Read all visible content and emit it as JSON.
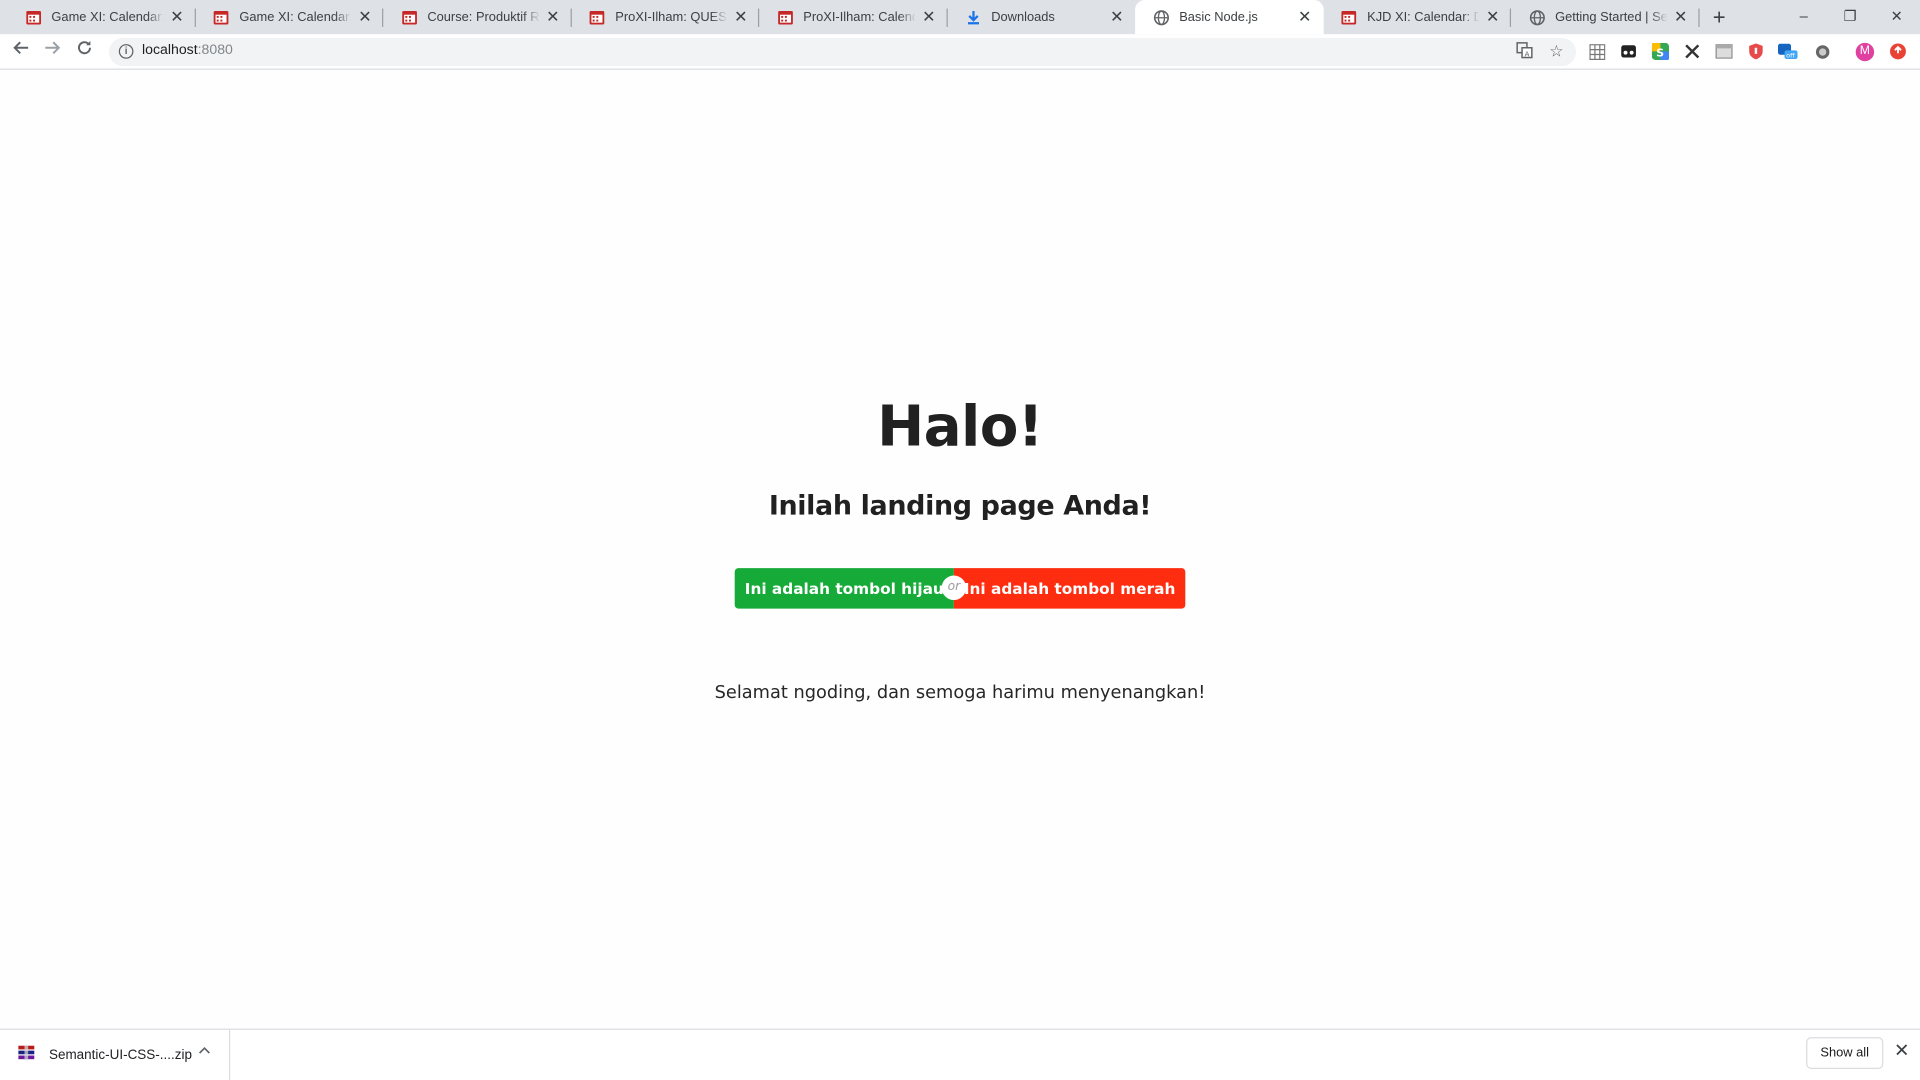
{
  "browser": {
    "tabs": [
      {
        "title": "Game XI: Calendar: Details",
        "icon": "google-classroom-icon",
        "active": false
      },
      {
        "title": "Game XI: Calendar: Details",
        "icon": "google-classroom-icon",
        "active": false
      },
      {
        "title": "Course: Produktif RPL XI",
        "icon": "google-classroom-icon",
        "active": false
      },
      {
        "title": "ProXI-Ilham: QUESTIONS",
        "icon": "google-classroom-icon",
        "active": false
      },
      {
        "title": "ProXI-Ilham: Calendar: Details",
        "icon": "google-classroom-icon",
        "active": false
      },
      {
        "title": "Downloads",
        "icon": "download-icon",
        "active": false
      },
      {
        "title": "Basic Node.js",
        "icon": "globe-icon",
        "active": true
      },
      {
        "title": "KJD XI: Calendar: Details",
        "icon": "google-classroom-icon",
        "active": false
      },
      {
        "title": "Getting Started | Semantic UI",
        "icon": "globe-icon",
        "active": false
      }
    ],
    "new_tab_label": "+",
    "window_controls": {
      "minimize": "–",
      "restore": "❐",
      "close": "✕"
    },
    "address": {
      "host": "localhost",
      "port": ":8080"
    },
    "profile_initial": "M",
    "colors": {
      "tabstrip": "#dee1e6",
      "profile": "#e040a0"
    }
  },
  "page": {
    "title": "Halo!",
    "subtitle": "Inilah landing page Anda!",
    "green_button": "Ini adalah tombol hijau",
    "or_label": "or",
    "red_button": "Ini adalah tombol merah",
    "greeting": "Selamat ngoding, dan semoga harimu menyenangkan!",
    "colors": {
      "green": "#16ab39",
      "red": "#ff2d0f"
    }
  },
  "download_shelf": {
    "file_name": "Semantic-UI-CSS-....zip",
    "show_all_label": "Show all"
  }
}
